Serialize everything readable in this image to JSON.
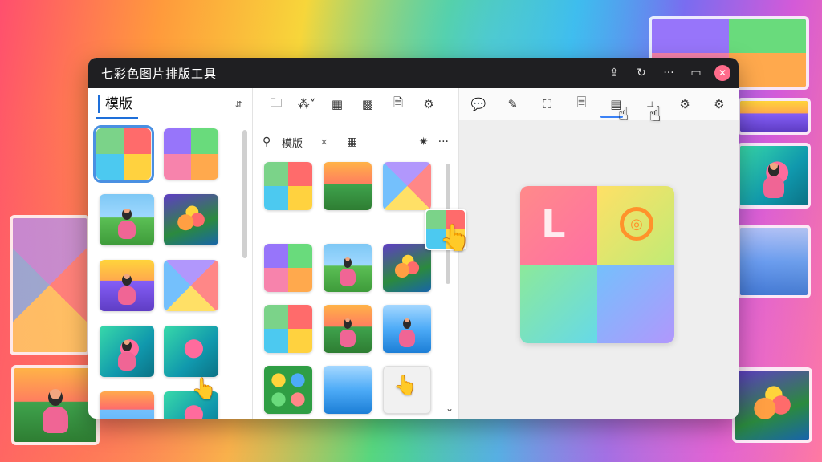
{
  "window": {
    "title": "七彩色图片排版工具",
    "buttons": {
      "share": "⇪",
      "refresh": "↻",
      "more": "···",
      "restore": "▭",
      "close": "✕"
    }
  },
  "left_panel": {
    "title": "模版",
    "more": "⇵"
  },
  "middle_panel": {
    "toolbar": [
      "folder-icon",
      "share-nodes-icon",
      "layout-grid-icon",
      "layout-blocks-icon",
      "document-icon",
      "settings-icon"
    ],
    "search": {
      "value": "模版",
      "clear": "✕"
    }
  },
  "right_panel": {
    "toolbar": [
      "comment-icon",
      "brush-icon",
      "crop-icon",
      "page-icon",
      "layout-icon",
      "scan-icon",
      "settings-icon",
      "gear-icon"
    ],
    "active_tool_index": 4
  },
  "colors": {
    "titlebar": "#1f1f22",
    "accent": "#1e6fd9",
    "close": "#ff6b8b"
  }
}
